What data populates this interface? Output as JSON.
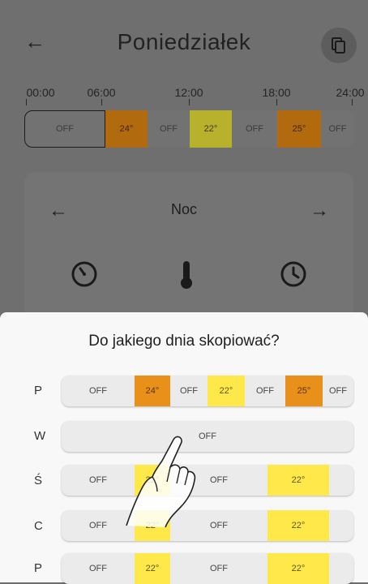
{
  "header": {
    "title": "Poniedziałek"
  },
  "timeline": {
    "ticks": [
      "00:00",
      "06:00",
      "12:00",
      "18:00",
      "24:00"
    ]
  },
  "schedule": {
    "segments": [
      "OFF",
      "24°",
      "OFF",
      "22°",
      "OFF",
      "25°",
      "OFF"
    ],
    "colors": {
      "orange": "#e8901a",
      "yellow": "#ffe94a",
      "dim_orange": "#b16a0d",
      "dim_yellow": "#b7b12c"
    }
  },
  "card": {
    "title": "Noc"
  },
  "sheet": {
    "title": "Do jakiego dnia skopiować?",
    "days": [
      {
        "label": "P",
        "segments": [
          "OFF",
          "24°",
          "OFF",
          "22°",
          "OFF",
          "25°",
          "OFF"
        ]
      },
      {
        "label": "W",
        "segments": [
          "OFF"
        ]
      },
      {
        "label": "Ś",
        "segments": [
          "OFF",
          "22°",
          "OFF",
          "22°"
        ]
      },
      {
        "label": "C",
        "segments": [
          "OFF",
          "22°",
          "OFF",
          "22°"
        ]
      },
      {
        "label": "P",
        "segments": [
          "OFF",
          "22°",
          "OFF",
          "22°"
        ]
      }
    ]
  }
}
